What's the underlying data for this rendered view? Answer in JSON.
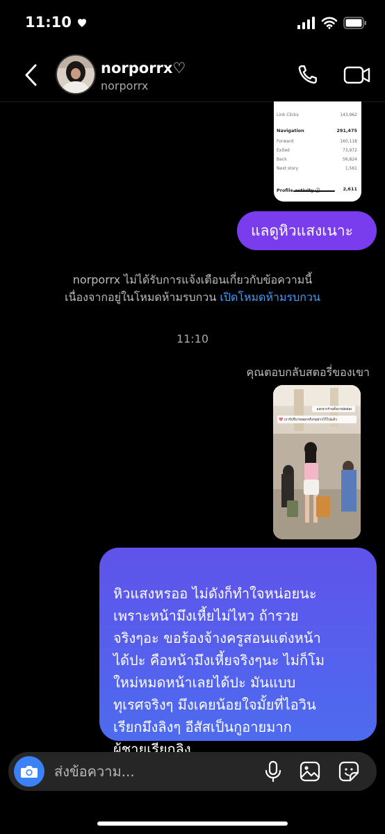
{
  "status_bar": {
    "time": "11:10"
  },
  "header": {
    "name": "norporrx♡",
    "handle": "norporrx"
  },
  "shared_insights": {
    "link_clicks_label": "Link Clicks",
    "link_clicks_value": "143,962",
    "navigation_label": "Navigation",
    "navigation_value": "291,475",
    "forward_label": "Forward",
    "forward_value": "160,118",
    "exited_label": "Exited",
    "exited_value": "73,972",
    "back_label": "Back",
    "back_value": "56,824",
    "next_story_label": "Next story",
    "next_story_value": "1,561",
    "profile_activity_label": "Profile activity ⓘ",
    "profile_activity_value": "2,611"
  },
  "messages": {
    "sent_1": "แลดูหิวแสงเนาะ",
    "notice_line1": "norporrx ไม่ได้รับการแจ้งเตือนเกี่ยวกับข้อความนี้",
    "notice_line2": "เนื่องจากอยู่ในโหมดห้ามรบกวน",
    "notice_link": "เปิดโหมดห้ามรบกวน",
    "timestamp": "11:10",
    "story_reply_label": "คุณตอบกลับสตอรี่ของเขา",
    "story_caption_top": "ออกจากร้านทั้งมาหลัยสอง",
    "story_caption_main": "💖 เรารับรีบาหลอกจริงๆอย่างไร้ไปแล้ว",
    "sent_2": "หิวแสงหรออ ไม่ดังก็ทำใจหน่อยนะ\nเพราะหน้ามึงเหี้ยไม่ไหว ถ้ารวย\nจริงๆอะ ขอร้องจ้างครูสอนแต่งหน้า\nได้ปะ คือหน้ามึงเหี้ยจริงๆนะ ไม่ก็โม\nใหม่หมดหน้าเลยได้ปะ มันแบบ\nทุเรศจริงๆ มึงเคยน้อยใจมั้ยที่ไอวิน\nเรียกมึงลิงๆ อีสัสเป็นกูอายมาก\nผู้ชายเรียกลิง"
  },
  "composer": {
    "placeholder": "ส่งข้อความ..."
  },
  "colors": {
    "sent_purple": "#7a3dee",
    "sent_blue": "#4d6bef",
    "link_blue": "#3e9bff",
    "camera_blue": "#3b82f6"
  }
}
